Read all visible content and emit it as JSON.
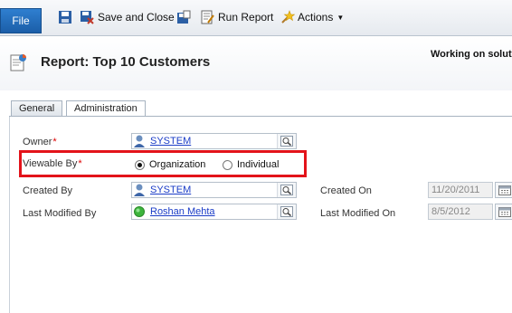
{
  "ribbon": {
    "file_label": "File",
    "save_close_label": "Save and Close",
    "run_report_label": "Run Report",
    "actions_label": "Actions"
  },
  "header": {
    "title": "Report: Top 10 Customers",
    "status_text": "Working on solut"
  },
  "tabs": [
    {
      "label": "General"
    },
    {
      "label": "Administration"
    }
  ],
  "form": {
    "owner": {
      "label": "Owner",
      "value": "SYSTEM"
    },
    "viewable_by": {
      "label": "Viewable By",
      "options": [
        "Organization",
        "Individual"
      ],
      "selected": "Organization"
    },
    "created_by": {
      "label": "Created By",
      "value": "SYSTEM"
    },
    "created_on": {
      "label": "Created On",
      "value": "11/20/2011"
    },
    "modified_by": {
      "label": "Last Modified By",
      "value": "Roshan Mehta"
    },
    "modified_on": {
      "label": "Last Modified On",
      "value": "8/5/2012"
    }
  },
  "colors": {
    "highlight": "#e3131a",
    "file_button": "#1b5ea8",
    "link": "#1a3cc7"
  }
}
